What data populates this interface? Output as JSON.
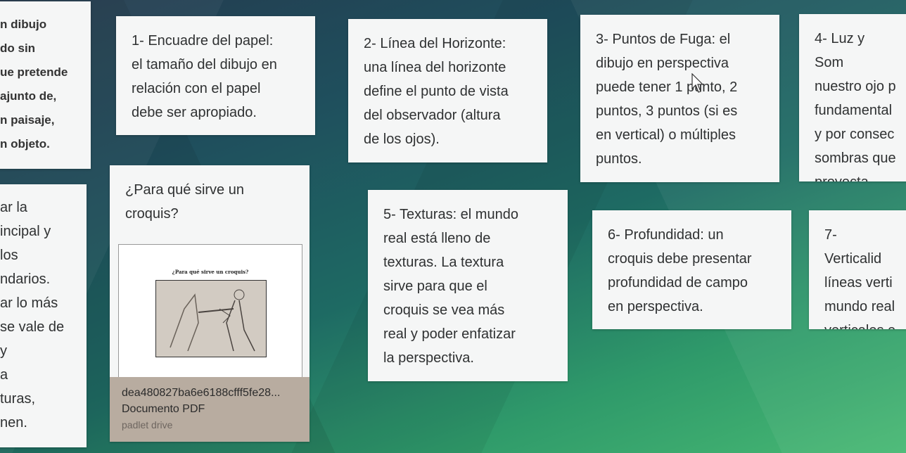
{
  "cards": {
    "left_top": "n dibujo\ndo sin\nue pretende\najunto de,\nn paisaje,\nn objeto.",
    "left_bottom": "ar la\nincipal y\nlos\nndarios.\nar lo más\nse vale de\ny\na\nturas,\nnen.",
    "c1": "1- Encuadre del papel:\nel tamaño del dibujo en\nrelación con el papel\ndebe ser apropiado.",
    "c2": "2- Línea del Horizonte:\nuna línea del horizonte\ndefine el punto de vista\ndel observador (altura\nde los ojos).",
    "c3": "3- Puntos de Fuga: el\ndibujo en perspectiva\npuede tener 1 punto, 2\npuntos, 3 puntos (si es\nen vertical) o múltiples\npuntos.",
    "c4": "4- Luz y Som\nnuestro ojo p\nfundamental\ny por consec\nsombras que\nproyecta.",
    "c5": "5- Texturas: el mundo\nreal está lleno de\ntexturas. La textura\nsirve para que el\ncroquis se vea  más\nreal y poder enfatizar\nla perspectiva.",
    "c6": "6- Profundidad: un\ncroquis debe presentar\nprofundidad de campo\nen perspectiva.",
    "c7": "7- Verticalid\nlíneas verti\nmundo real\nverticales e"
  },
  "pdf_card": {
    "title": "¿Para qué sirve un\ncroquis?",
    "preview_title": "¿Para qué sirve un croquis?",
    "file_name": "dea480827ba6e6188cfff5fe28...",
    "file_type": "Documento PDF",
    "source": "padlet drive"
  },
  "icons": {
    "cursor": "mouse-pointer-icon",
    "pdf_preview": "document-preview-icon"
  },
  "colors": {
    "card_bg": "#f5f6f6",
    "attachment_footer": "#b8aca0"
  }
}
